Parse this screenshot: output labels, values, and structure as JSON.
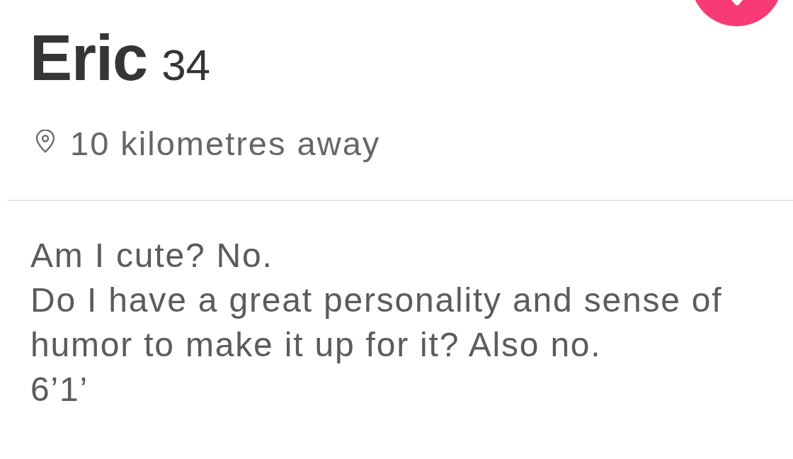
{
  "profile": {
    "name": "Eric",
    "age": "34",
    "distance": "10 kilometres away",
    "bio": [
      "Am I cute? No.",
      "Do I have a great personality and sense of humor to make it up for it? Also no.",
      "6’1’"
    ]
  }
}
